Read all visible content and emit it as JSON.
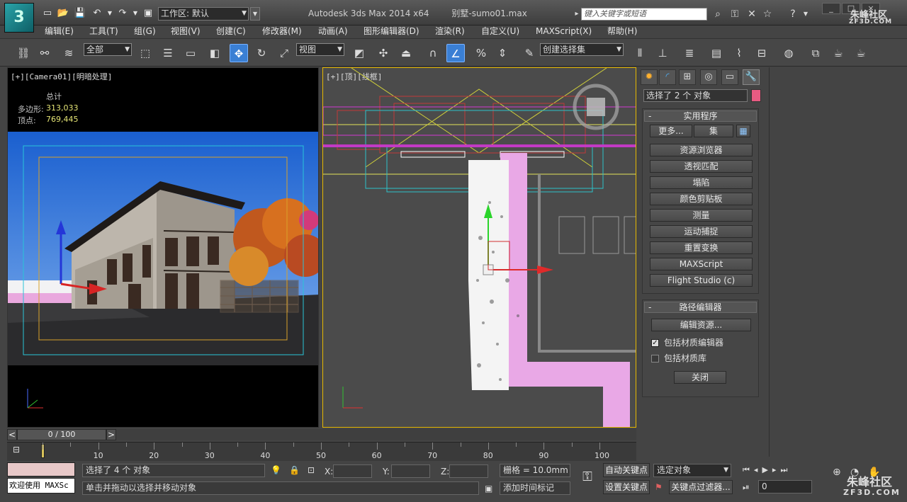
{
  "titlebar": {
    "logo_text": "3",
    "workspace_label": "工作区: 默认",
    "app_title": "Autodesk 3ds Max  2014 x64",
    "file_name": "别墅-sumo01.max",
    "search_placeholder": "键入关键字或短语",
    "watermark": "朱峰社区",
    "watermark_sub": "ZF3D.COM"
  },
  "menubar": [
    "编辑(E)",
    "工具(T)",
    "组(G)",
    "视图(V)",
    "创建(C)",
    "修改器(M)",
    "动画(A)",
    "图形编辑器(D)",
    "渲染(R)",
    "自定义(U)",
    "MAXScript(X)",
    "帮助(H)"
  ],
  "toolbar": {
    "filter_value": "全部",
    "coord_value": "视图",
    "named_selection_value": "创建选择集"
  },
  "viewport_camera": {
    "label": "[+][Camera01][明暗处理]",
    "stats_title": "总计",
    "polys_label": "多边形:",
    "polys_value": "313,033",
    "verts_label": "顶点:",
    "verts_value": "769,445"
  },
  "viewport_top": {
    "label": "[+][顶][线框]"
  },
  "command_panel": {
    "selection_info": "选择了 2 个 对象",
    "selection_color": "#e85b82",
    "utilities": {
      "title": "实用程序",
      "more_label": "更多...",
      "sets_label": "集",
      "buttons": [
        "资源浏览器",
        "透视匹配",
        "塌陷",
        "颜色剪贴板",
        "测量",
        "运动捕捉",
        "重置变换",
        "MAXScript",
        "Flight Studio (c)"
      ]
    },
    "path_editor": {
      "title": "路径编辑器",
      "edit_resources": "编辑资源...",
      "include_mat_editor": "包括材质编辑器",
      "include_mat_editor_checked": true,
      "include_mat_library": "包括材质库",
      "include_mat_library_checked": false,
      "close_label": "关闭"
    }
  },
  "timeline": {
    "frame_readout": "0 / 100",
    "prev": "<",
    "next": ">",
    "ticks": [
      "10",
      "20",
      "30",
      "40",
      "50",
      "60",
      "70",
      "80",
      "90",
      "100"
    ]
  },
  "statusbar": {
    "maxscript_listener": "欢迎使用 MAXSc",
    "selection_status": "选择了 4 个 对象",
    "prompt": "单击并拖动以选择并移动对象",
    "x_label": "X:",
    "y_label": "Y:",
    "z_label": "Z:",
    "grid_label": "栅格 = 10.0mm",
    "add_time_tag": "添加时间标记",
    "auto_key": "自动关键点",
    "set_key": "设置关键点",
    "key_mode_value": "选定对象",
    "key_filters": "关键点过滤器...",
    "current_frame": "0"
  }
}
